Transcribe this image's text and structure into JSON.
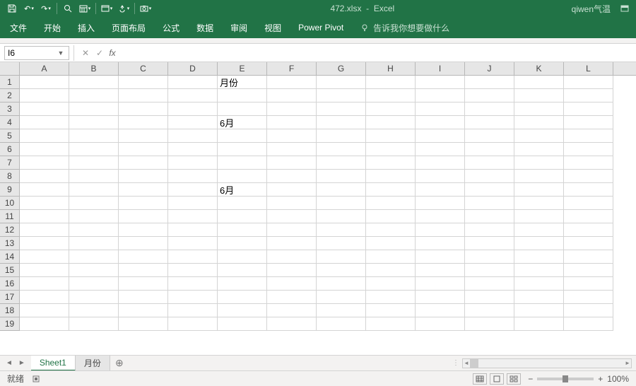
{
  "title": {
    "filename": "472.xlsx",
    "appname": "Excel",
    "username": "qiwen气温"
  },
  "tabs": {
    "file": "文件",
    "home": "开始",
    "insert": "插入",
    "layout": "页面布局",
    "formulas": "公式",
    "data": "数据",
    "review": "审阅",
    "view": "视图",
    "powerpivot": "Power Pivot",
    "tellme": "告诉我你想要做什么"
  },
  "namebox": "I6",
  "formula": "",
  "columns": [
    "A",
    "B",
    "C",
    "D",
    "E",
    "F",
    "G",
    "H",
    "I",
    "J",
    "K",
    "L"
  ],
  "rows": [
    "1",
    "2",
    "3",
    "4",
    "5",
    "6",
    "7",
    "8",
    "9",
    "10",
    "11",
    "12",
    "13",
    "14",
    "15",
    "16",
    "17",
    "18",
    "19"
  ],
  "cells": {
    "E1": "月份",
    "E4": "6月",
    "E9": "6月"
  },
  "sheets": {
    "s1": "Sheet1",
    "s2": "月份"
  },
  "status": {
    "ready": "就绪",
    "zoom": "100%"
  }
}
